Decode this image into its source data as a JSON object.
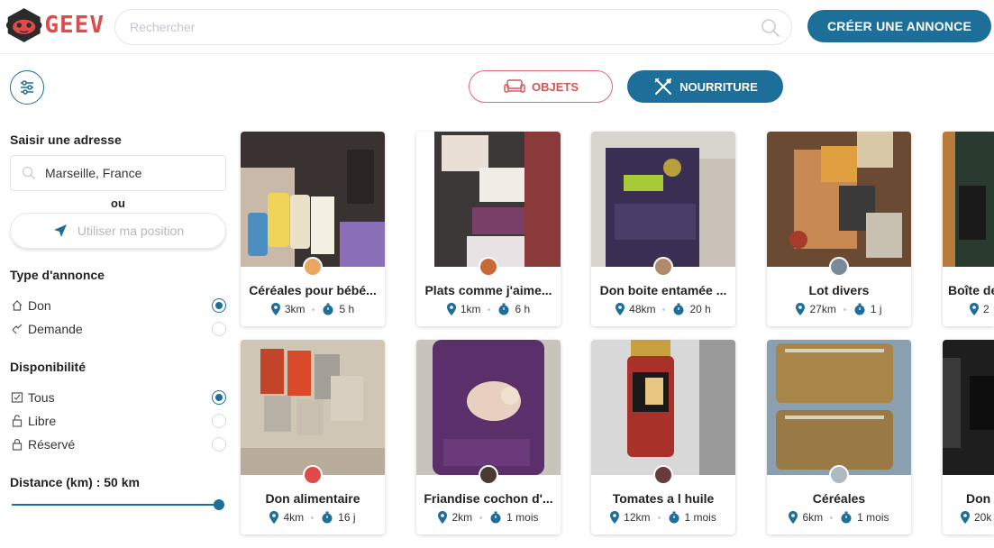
{
  "header": {
    "logo_text": "GEEV",
    "search_placeholder": "Rechercher",
    "create_label": "CRÉER UNE ANNONCE"
  },
  "categories": {
    "objets": "OBJETS",
    "nourriture": "NOURRITURE",
    "active": "NOURRITURE"
  },
  "sidebar": {
    "address_title": "Saisir une adresse",
    "address_value": "Marseille, France",
    "or_label": "ou",
    "use_position": "Utiliser ma position",
    "type_title": "Type d'annonce",
    "type_options": [
      {
        "label": "Don",
        "selected": true
      },
      {
        "label": "Demande",
        "selected": false
      }
    ],
    "dispo_title": "Disponibilité",
    "dispo_options": [
      {
        "label": "Tous",
        "selected": true
      },
      {
        "label": "Libre",
        "selected": false
      },
      {
        "label": "Réservé",
        "selected": false
      }
    ],
    "distance_label": "Distance (km) : 50 km",
    "distance_value_km": 50,
    "distance_max_km": 50
  },
  "colors": {
    "primary": "#1d6f9a",
    "accent_red": "#e04a4a"
  },
  "listings": [
    {
      "title": "Céréales pour bébé...",
      "distance": "3km",
      "time": "5 h"
    },
    {
      "title": "Plats comme j'aime...",
      "distance": "1km",
      "time": "6 h"
    },
    {
      "title": "Don boite entamée ...",
      "distance": "48km",
      "time": "20 h"
    },
    {
      "title": "Lot divers",
      "distance": "27km",
      "time": "1 j"
    },
    {
      "title": "Boîte de",
      "distance": "2",
      "time": ""
    },
    {
      "title": "Don alimentaire",
      "distance": "4km",
      "time": "16 j"
    },
    {
      "title": "Friandise cochon d'...",
      "distance": "2km",
      "time": "1 mois"
    },
    {
      "title": "Tomates a l huile",
      "distance": "12km",
      "time": "1 mois"
    },
    {
      "title": "Céréales",
      "distance": "6km",
      "time": "1 mois"
    },
    {
      "title": "Don",
      "distance": "20k",
      "time": ""
    }
  ]
}
